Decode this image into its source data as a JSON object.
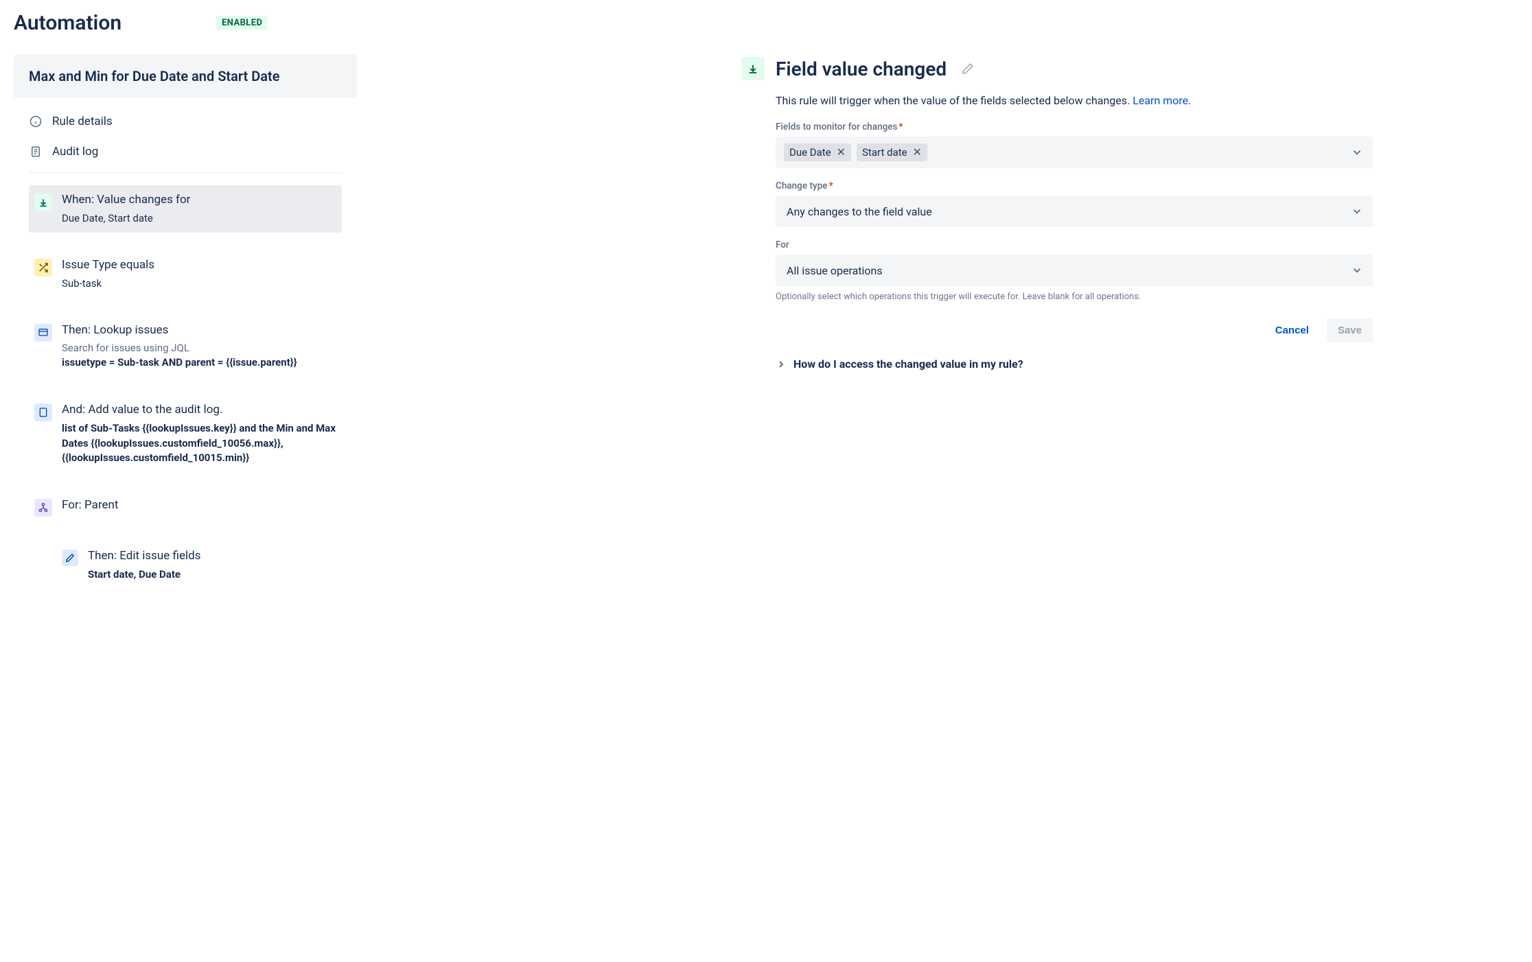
{
  "header": {
    "title": "Automation",
    "status_badge": "ENABLED"
  },
  "rule": {
    "name": "Max and Min for Due Date and Start Date",
    "meta": {
      "details_label": "Rule details",
      "audit_label": "Audit log"
    },
    "steps": {
      "trigger": {
        "title": "When: Value changes for",
        "sub": "Due Date, Start date"
      },
      "condition": {
        "title": "Issue Type equals",
        "sub": "Sub-task"
      },
      "lookup": {
        "title": "Then: Lookup issues",
        "sub_light": "Search for issues using JQL",
        "bold": "issuetype = Sub-task AND parent = {{issue.parent}}"
      },
      "audit": {
        "title": "And: Add value to the audit log.",
        "bold": "list of Sub-Tasks {{lookupIssues.key}} and the Min and Max Dates {{lookupIssues.customfield_10056.max}}, {{lookupIssues.customfield_10015.min}}"
      },
      "branch": {
        "title": "For: Parent"
      },
      "edit": {
        "title": "Then: Edit issue fields",
        "bold": "Start date, Due Date"
      }
    }
  },
  "details": {
    "header_title": "Field value changed",
    "description": "This rule will trigger when the value of the fields selected below changes. ",
    "learn_more": "Learn more.",
    "fields_label": "Fields to monitor for changes",
    "fields_chips": [
      "Due Date",
      "Start date"
    ],
    "change_type_label": "Change type",
    "change_type_value": "Any changes to the field value",
    "for_label": "For",
    "for_value": "All issue operations",
    "for_help": "Optionally select which operations this trigger will execute for. Leave blank for all operations.",
    "cancel_label": "Cancel",
    "save_label": "Save",
    "expander_label": "How do I access the changed value in my rule?"
  }
}
